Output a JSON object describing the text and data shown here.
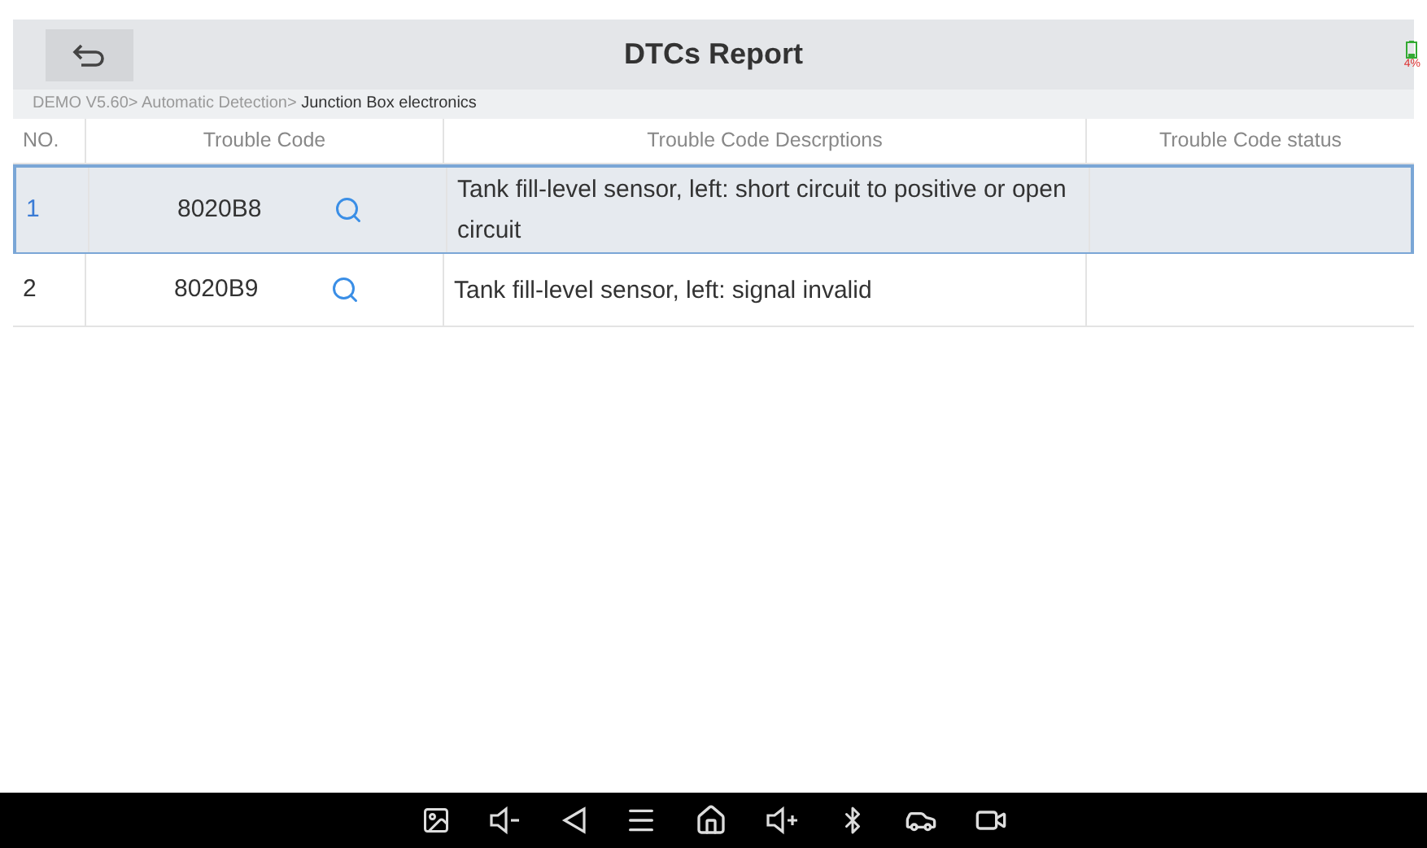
{
  "header": {
    "title": "DTCs Report",
    "battery_percent": "4%"
  },
  "breadcrumb": "DEMO V5.60> Automatic Detection> **Junction Box electronics**",
  "table": {
    "columns": [
      "NO.",
      "Trouble Code",
      "Trouble Code Descrptions",
      "Trouble Code status"
    ],
    "rows": [
      {
        "no": "1",
        "code": "8020B8",
        "description": "Tank fill-level sensor, left: short circuit to positive or open circuit",
        "selected": true
      },
      {
        "no": "2",
        "code": "8020B9",
        "description": "Tank fill-level sensor, left: signal invalid",
        "selected": false
      }
    ]
  }
}
